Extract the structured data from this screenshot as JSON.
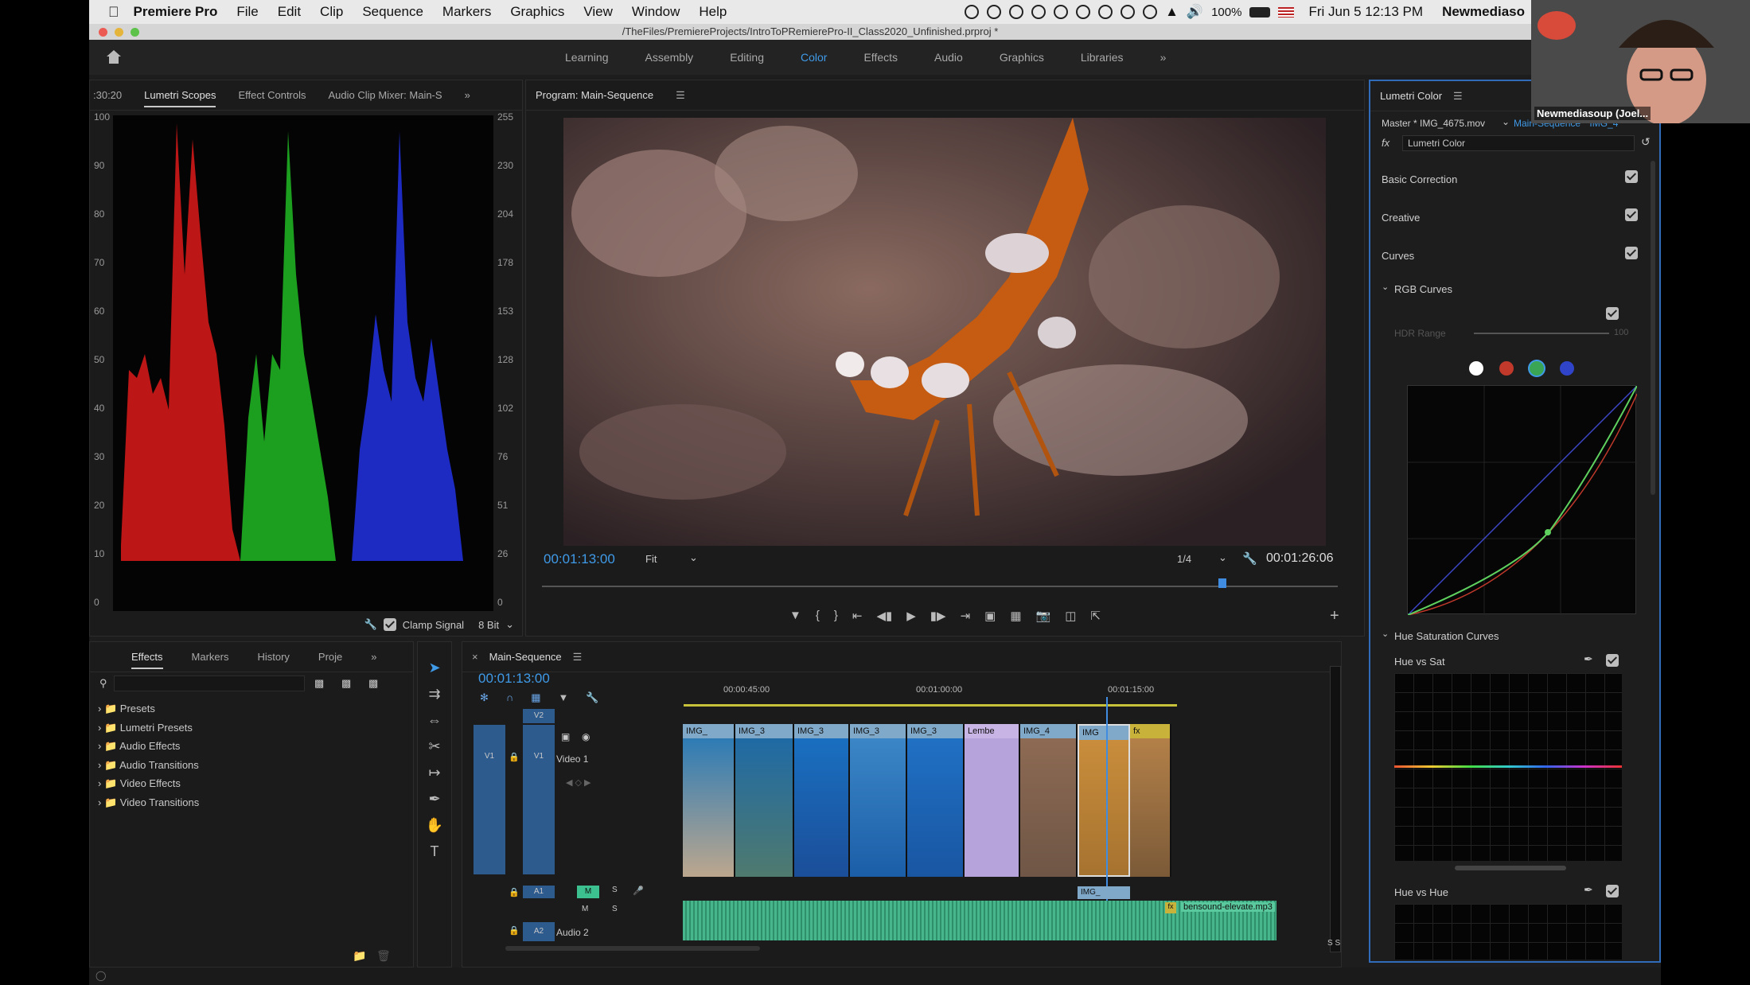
{
  "menubar": {
    "app": "Premiere Pro",
    "items": [
      "File",
      "Edit",
      "Clip",
      "Sequence",
      "Markers",
      "Graphics",
      "View",
      "Window",
      "Help"
    ],
    "battery": "100%",
    "datetime": "Fri Jun 5  12:13 PM",
    "user": "Newmediaso"
  },
  "titlebar": {
    "path": "/TheFiles/PremiereProjects/IntroToPRemierePro-II_Class2020_Unfinished.prproj *"
  },
  "workspaces": {
    "items": [
      "Learning",
      "Assembly",
      "Editing",
      "Color",
      "Effects",
      "Audio",
      "Graphics",
      "Libraries"
    ],
    "active": "Color"
  },
  "scopes": {
    "timecode_left": ":30:20",
    "tabs": [
      "Lumetri Scopes",
      "Effect Controls",
      "Audio Clip Mixer: Main-S"
    ],
    "active": "Lumetri Scopes",
    "left_ticks": [
      "100",
      "90",
      "80",
      "70",
      "60",
      "50",
      "40",
      "30",
      "20",
      "10",
      "0"
    ],
    "right_ticks": [
      "255",
      "230",
      "204",
      "178",
      "153",
      "128",
      "102",
      "76",
      "51",
      "26",
      "0"
    ],
    "clamp_label": "Clamp Signal",
    "bit_depth": "8 Bit"
  },
  "program": {
    "title": "Program: Main-Sequence",
    "timecode": "00:01:13:00",
    "fit": "Fit",
    "resolution": "1/4",
    "duration": "00:01:26:06"
  },
  "effects": {
    "tabs": [
      "Effects",
      "Markers",
      "History",
      "Proje"
    ],
    "active": "Effects",
    "folders": [
      "Presets",
      "Lumetri Presets",
      "Audio Effects",
      "Audio Transitions",
      "Video Effects",
      "Video Transitions"
    ]
  },
  "timeline": {
    "title": "Main-Sequence",
    "timecode": "00:01:13:00",
    "ruler": [
      "00:00:45:00",
      "00:01:00:00",
      "00:01:15:00"
    ],
    "tracks": {
      "v2": "V2",
      "v1": "V1",
      "video1": "Video 1",
      "a1": "A1",
      "a2": "A2",
      "audio2": "Audio 2",
      "m": "M",
      "s": "S"
    },
    "clips": [
      "IMG_",
      "IMG_3",
      "IMG_3",
      "IMG_3",
      "IMG_3",
      "Lembe",
      "IMG_4",
      "IMG",
      "fx"
    ],
    "a1clip": "IMG_",
    "audio_file": "bensound-elevate.mp3",
    "meter": "S S"
  },
  "lumetri": {
    "title": "Lumetri Color",
    "master": "Master * IMG_4675.mov",
    "seq": "Main-Sequence * IMG_4",
    "effect": "Lumetri Color",
    "sections": [
      "Basic Correction",
      "Creative",
      "Curves"
    ],
    "rgb_curves": "RGB Curves",
    "hdr_range": "HDR Range",
    "hdr_value": "100",
    "hue_sat_curves": "Hue Saturation Curves",
    "hue_vs_sat": "Hue vs Sat",
    "hue_vs_hue": "Hue vs Hue",
    "curve_colors": [
      "#ffffff",
      "#c0392b",
      "#3aa655",
      "#2f44c9"
    ]
  },
  "webcam": {
    "name": "Newmediasoup (Joel..."
  }
}
